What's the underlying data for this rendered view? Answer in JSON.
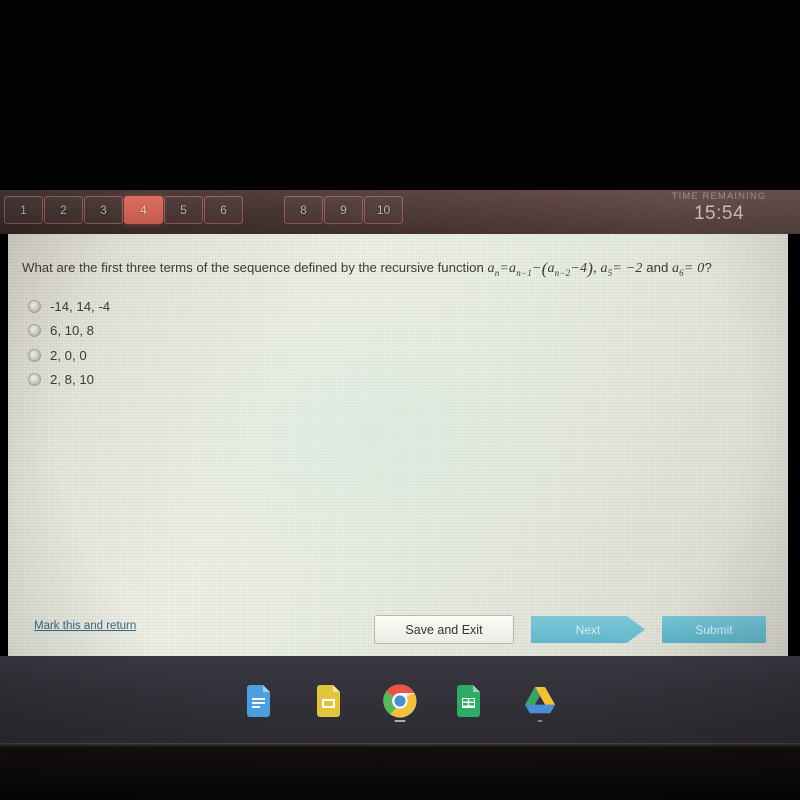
{
  "exam": {
    "question_tabs": [
      {
        "label": "1",
        "state": "normal"
      },
      {
        "label": "2",
        "state": "normal"
      },
      {
        "label": "3",
        "state": "normal"
      },
      {
        "label": "4",
        "state": "current"
      },
      {
        "label": "5",
        "state": "normal"
      },
      {
        "label": "6",
        "state": "normal"
      },
      {
        "label": "",
        "state": "blank"
      },
      {
        "label": "8",
        "state": "normal"
      },
      {
        "label": "9",
        "state": "normal"
      },
      {
        "label": "10",
        "state": "normal"
      }
    ],
    "timer": {
      "label": "TIME REMAINING",
      "value": "15:54"
    },
    "accent_color": "#e2695a",
    "header_bg": "#4a3532",
    "question": {
      "prompt": "What are the first three terms of the sequence defined by the recursive function",
      "formula_plain": "a_n = a_{n-1} - (a_{n-2} - 4), a_5 = -2 and a_6 = 0?",
      "formula": {
        "lhs_var": "a",
        "lhs_sub": "n",
        "eq": "=",
        "t1_var": "a",
        "t1_sub": "n−1",
        "minus": "−",
        "open": "(",
        "t2_var": "a",
        "t2_sub": "n−2",
        "t2_const": "−4",
        "close": ")",
        "comma": ",",
        "given1_var": "a",
        "given1_sub": "5",
        "given1_val": "= −2",
        "and": "and",
        "given2_var": "a",
        "given2_sub": "6",
        "given2_val": "= 0",
        "qmark": "?"
      }
    },
    "options": [
      {
        "label": "-14, 14, -4",
        "selected": false
      },
      {
        "label": "6, 10, 8",
        "selected": false
      },
      {
        "label": "2, 0, 0",
        "selected": false
      },
      {
        "label": "2, 8, 10",
        "selected": false
      }
    ],
    "footer": {
      "mark_link": "Mark this and return",
      "save_button": "Save and Exit",
      "next_button": "Next",
      "submit_button": "Submit",
      "button_color": "#63b6c9",
      "link_color": "#3a6a86"
    }
  },
  "taskbar": {
    "apps": [
      {
        "name": "google-docs-icon",
        "running": false
      },
      {
        "name": "google-slides-icon",
        "running": false
      },
      {
        "name": "google-chrome-icon",
        "running": true
      },
      {
        "name": "google-sheets-icon",
        "running": false
      },
      {
        "name": "google-drive-icon",
        "running": true
      }
    ]
  }
}
